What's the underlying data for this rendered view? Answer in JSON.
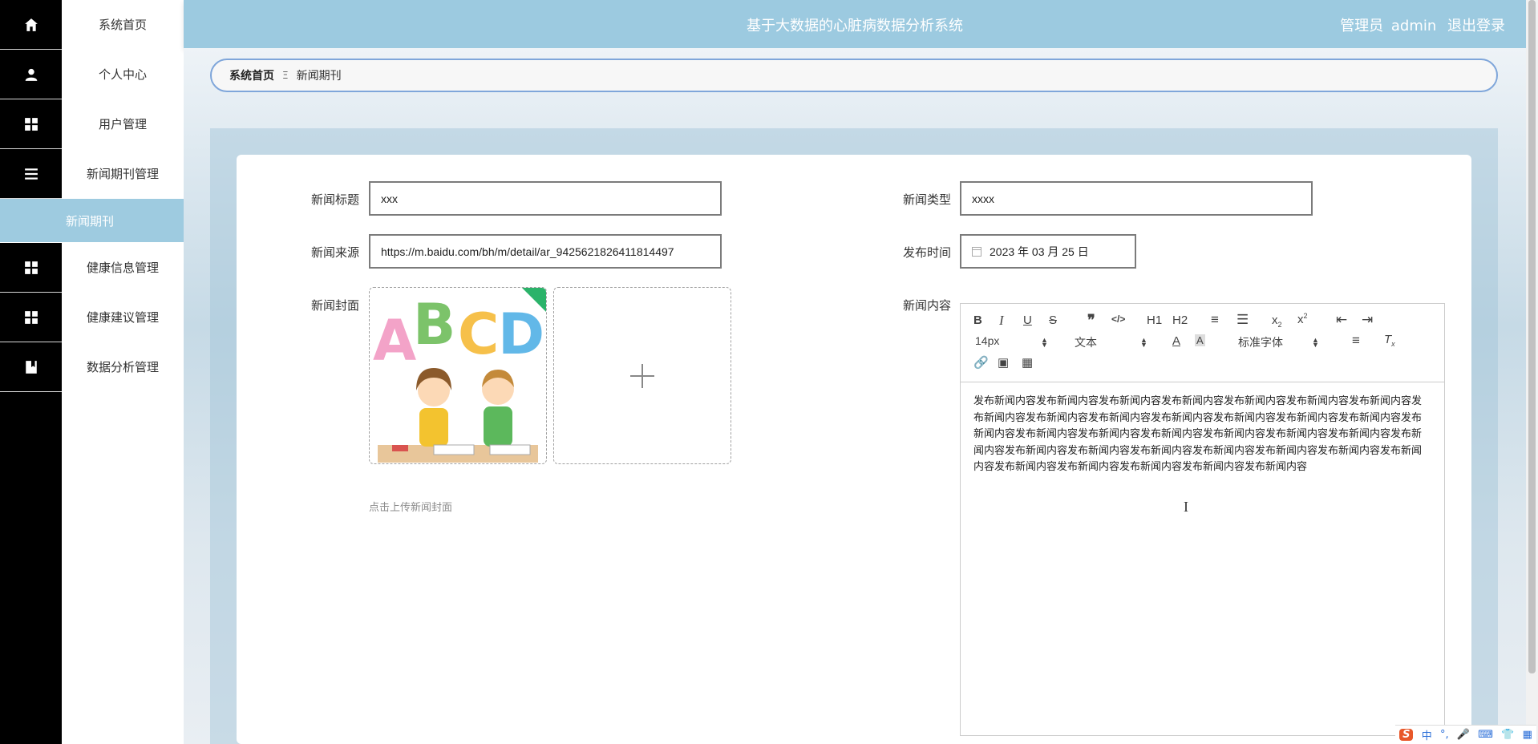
{
  "header": {
    "title": "基于大数据的心脏病数据分析系统",
    "user_role": "管理员",
    "username": "admin",
    "logout": "退出登录"
  },
  "sidebar": {
    "items": [
      {
        "label": "系统首页",
        "icon": "home-icon"
      },
      {
        "label": "个人中心",
        "icon": "user-icon"
      },
      {
        "label": "用户管理",
        "icon": "grid-icon"
      },
      {
        "label": "新闻期刊管理",
        "icon": "list-icon"
      },
      {
        "label": "新闻期刊",
        "icon": ""
      },
      {
        "label": "健康信息管理",
        "icon": "grid-icon"
      },
      {
        "label": "健康建议管理",
        "icon": "grid-icon"
      },
      {
        "label": "数据分析管理",
        "icon": "book-icon"
      }
    ]
  },
  "breadcrumb": {
    "home": "系统首页",
    "separator": "Ξ",
    "current": "新闻期刊"
  },
  "form": {
    "title_label": "新闻标题",
    "title_value": "xxx",
    "type_label": "新闻类型",
    "type_value": "xxxx",
    "source_label": "新闻来源",
    "source_value": "https://m.baidu.com/bh/m/detail/ar_9425621826411814497",
    "time_label": "发布时间",
    "time_value": "2023 年 03 月 25 日",
    "cover_label": "新闻封面",
    "cover_hint": "点击上传新闻封面",
    "content_label": "新闻内容"
  },
  "editor": {
    "font_size": "14px",
    "header_select": "文本",
    "font_family": "标准字体",
    "h1": "H1",
    "h2": "H2",
    "content": "发布新闻内容发布新闻内容发布新闻内容发布新闻内容发布新闻内容发布新闻内容发布新闻内容发布新闻内容发布新闻内容发布新闻内容发布新闻内容发布新闻内容发布新闻内容发布新闻内容发布新闻内容发布新闻内容发布新闻内容发布新闻内容发布新闻内容发布新闻内容发布新闻内容发布新闻内容发布新闻内容发布新闻内容发布新闻内容发布新闻内容发布新闻内容发布新闻内容发布新闻内容发布新闻内容发布新闻内容发布新闻内容发布新闻内容发布新闻内容"
  },
  "cover_image": {
    "letters": [
      "A",
      "B",
      "C",
      "D"
    ]
  },
  "ime": {
    "lang": "中"
  },
  "colors": {
    "header": "#9ccae0",
    "active_menu": "#9ecbe0",
    "breadcrumb_border": "#7fa6da"
  }
}
